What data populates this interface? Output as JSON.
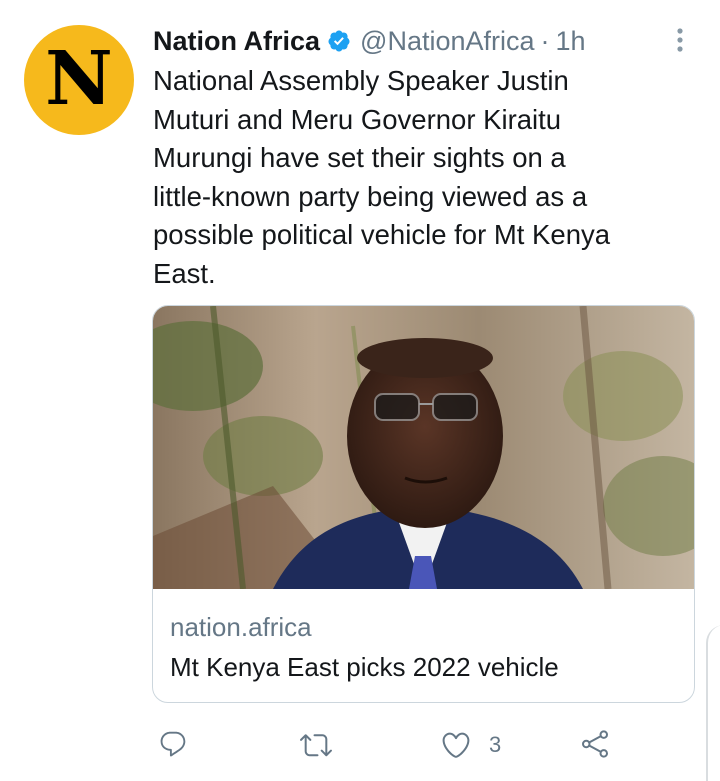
{
  "author": {
    "avatar_letter": "N",
    "display_name": "Nation Africa",
    "handle": "@NationAfrica",
    "separator": "·",
    "time": "1h",
    "verified_icon": "verified-badge-icon"
  },
  "tweet": {
    "text_lines": [
      "National Assembly Speaker Justin",
      "Muturi and Meru Governor Kiraitu",
      "Murungi have set their sights on a",
      "little-known party being viewed as a",
      "possible political vehicle for Mt Kenya",
      "East."
    ]
  },
  "card": {
    "domain": "nation.africa",
    "title": "Mt Kenya East picks 2022 vehicle",
    "image_icon": "news-photo"
  },
  "actions": {
    "reply_icon": "reply-icon",
    "retweet_icon": "retweet-icon",
    "like_icon": "heart-icon",
    "like_count": "3",
    "share_icon": "share-icon"
  },
  "colors": {
    "avatar_bg": "#f6b91c",
    "verified": "#1da1f2",
    "secondary_text": "#657786",
    "primary_text": "#14171a",
    "action_icon": "#657786"
  }
}
